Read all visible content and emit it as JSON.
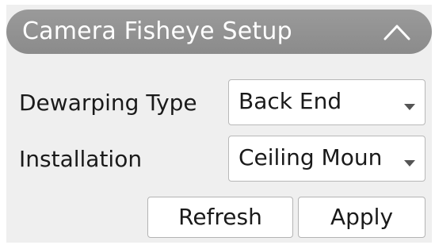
{
  "panel": {
    "title": "Camera Fisheye Setup",
    "collapse_icon": "chevron-up-icon"
  },
  "fields": [
    {
      "label": "Dewarping Type",
      "value": "Back End",
      "icon": "dropdown-arrow-icon"
    },
    {
      "label": "Installation",
      "value": "Ceiling Moun",
      "icon": "dropdown-arrow-icon"
    }
  ],
  "buttons": {
    "refresh_label": "Refresh",
    "apply_label": "Apply"
  },
  "colors": {
    "header_bg": "#8e8e8e",
    "header_text": "#ffffff",
    "panel_bg": "#efefef"
  }
}
